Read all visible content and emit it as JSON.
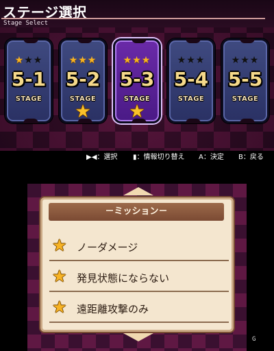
{
  "header": {
    "title": "ステージ選択",
    "subtitle": "Stage Select"
  },
  "stages": [
    {
      "id": "5-1",
      "label": "STAGE",
      "stars_earned": 1,
      "stars_total": 3,
      "selected": false,
      "cleared": false
    },
    {
      "id": "5-2",
      "label": "STAGE",
      "stars_earned": 3,
      "stars_total": 3,
      "selected": false,
      "cleared": true
    },
    {
      "id": "5-3",
      "label": "STAGE",
      "stars_earned": 3,
      "stars_total": 3,
      "selected": true,
      "cleared": true
    },
    {
      "id": "5-4",
      "label": "STAGE",
      "stars_earned": 0,
      "stars_total": 3,
      "selected": false,
      "cleared": false
    },
    {
      "id": "5-5",
      "label": "STAGE",
      "stars_earned": 0,
      "stars_total": 3,
      "selected": false,
      "cleared": false
    }
  ],
  "controls": {
    "select": "▶◀：選択",
    "info": "▮：情報切り替え",
    "confirm": "A：決定",
    "back": "B：戻る"
  },
  "mission": {
    "header": "－ミッション－",
    "items": [
      {
        "text": "ノーダメージ"
      },
      {
        "text": "発見状態にならない"
      },
      {
        "text": "遠距離攻撃のみ"
      }
    ]
  },
  "colors": {
    "star_gold": "#f7b324",
    "card_blue": "#3f4a80",
    "card_selected": "#6a2aa8",
    "panel_bg": "#f4e6cf",
    "panel_header": "#8c5a3e"
  },
  "icons": {
    "star": "star-icon",
    "arrow_up": "scroll-up-icon",
    "arrow_down": "scroll-down-icon"
  },
  "watermark": "G"
}
